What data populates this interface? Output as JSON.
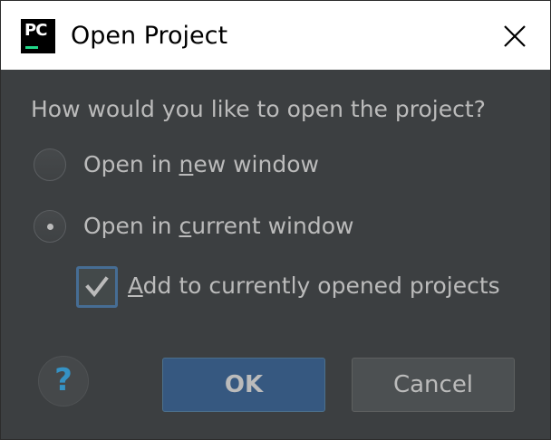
{
  "window": {
    "title": "Open Project",
    "app_icon_text": "PC"
  },
  "dialog": {
    "question": "How would you like to open the project?",
    "options": [
      {
        "pre": "Open in ",
        "mnemonic": "n",
        "post": "ew window",
        "selected": false
      },
      {
        "pre": "Open in ",
        "mnemonic": "c",
        "post": "urrent window",
        "selected": true
      }
    ],
    "checkbox": {
      "mnemonic": "A",
      "post": "dd to currently opened projects",
      "checked": true
    },
    "help_symbol": "?",
    "buttons": {
      "ok": "OK",
      "cancel": "Cancel"
    }
  },
  "colors": {
    "dialog_background": "#3c3f41",
    "default_button": "#365880",
    "text": "#bbbbbb",
    "help_icon": "#3592c4"
  },
  "icons": {
    "app": "pycharm-logo-icon",
    "close": "close-icon",
    "help": "help-icon",
    "check": "checkmark-icon"
  }
}
